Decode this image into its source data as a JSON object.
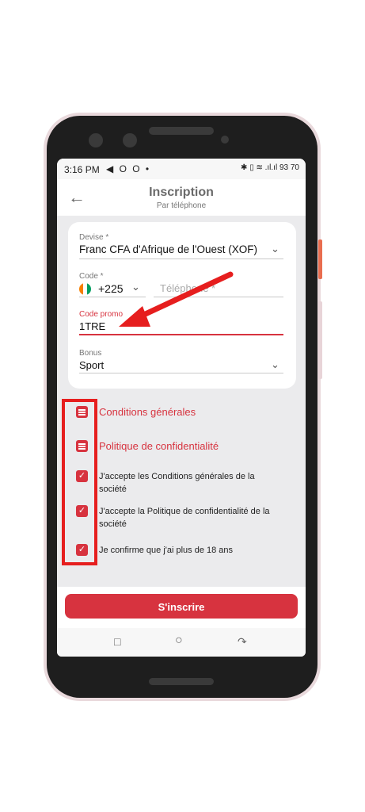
{
  "status": {
    "time": "3:16 PM",
    "left_icons": "◀ O O •",
    "right_icons": "✱ ▯ ≋ .ıl.ıl 93 70"
  },
  "header": {
    "back_icon": "arrow-left",
    "title": "Inscription",
    "subtitle": "Par téléphone"
  },
  "form": {
    "devise_label": "Devise *",
    "devise_value": "Franc CFA d'Afrique de l'Ouest (XOF)",
    "code_label": "Code *",
    "code_value": "+225",
    "phone_placeholder": "Téléphone *",
    "promo_label": "Code promo",
    "promo_value": "1TRE",
    "bonus_label": "Bonus",
    "bonus_value": "Sport"
  },
  "links": [
    {
      "label": "Conditions générales"
    },
    {
      "label": "Politique de confidentialité"
    }
  ],
  "checks": [
    {
      "label": "J'accepte les Conditions générales de la société",
      "checked": true
    },
    {
      "label": "J'accepte la Politique de confidentialité de la société",
      "checked": true
    },
    {
      "label": "Je confirme que j'ai plus de 18 ans",
      "checked": true
    }
  ],
  "actions": {
    "submit_label": "S'inscrire"
  },
  "nav": {
    "recent_icon": "recent-apps",
    "home_icon": "home",
    "back_icon": "back"
  },
  "colors": {
    "accent": "#d7333f",
    "annotation": "#e61e1e",
    "background": "#ebebed"
  }
}
